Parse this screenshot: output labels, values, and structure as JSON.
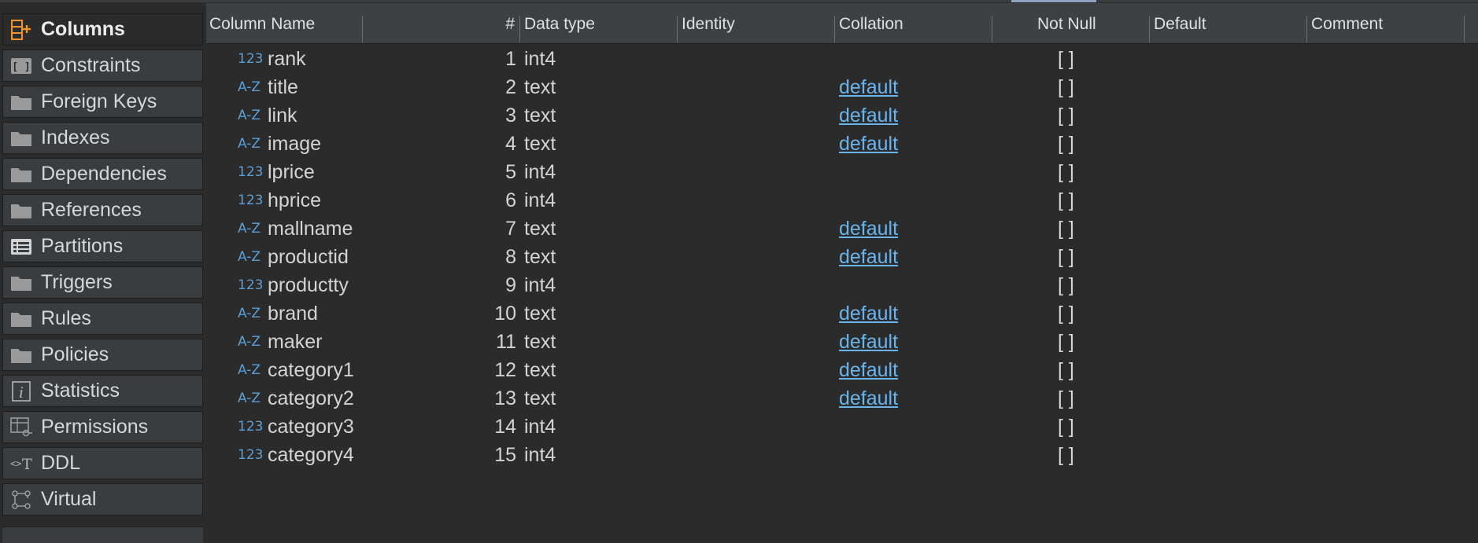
{
  "sidebar": {
    "items": [
      {
        "label": "Columns",
        "icon": "columns-icon",
        "active": true
      },
      {
        "label": "Constraints",
        "icon": "constraints-icon"
      },
      {
        "label": "Foreign Keys",
        "icon": "folder-icon"
      },
      {
        "label": "Indexes",
        "icon": "folder-icon"
      },
      {
        "label": "Dependencies",
        "icon": "folder-icon"
      },
      {
        "label": "References",
        "icon": "folder-icon"
      },
      {
        "label": "Partitions",
        "icon": "partitions-icon"
      },
      {
        "label": "Triggers",
        "icon": "folder-icon"
      },
      {
        "label": "Rules",
        "icon": "folder-icon"
      },
      {
        "label": "Policies",
        "icon": "folder-icon"
      },
      {
        "label": "Statistics",
        "icon": "statistics-icon"
      },
      {
        "label": "Permissions",
        "icon": "permissions-icon"
      },
      {
        "label": "DDL",
        "icon": "ddl-icon"
      },
      {
        "label": "Virtual",
        "icon": "virtual-icon"
      }
    ]
  },
  "table": {
    "headers": {
      "name": "Column Name",
      "num": "#",
      "type": "Data type",
      "identity": "Identity",
      "collation": "Collation",
      "notnull": "Not Null",
      "default": "Default",
      "comment": "Comment"
    },
    "type_icons": {
      "numeric": "123",
      "text": "A-Z"
    },
    "rows": [
      {
        "icon": "123",
        "name": "rank",
        "num": "1",
        "type": "int4",
        "collation": "",
        "notnull": "[ ]"
      },
      {
        "icon": "A-Z",
        "name": "title",
        "num": "2",
        "type": "text",
        "collation": "default",
        "notnull": "[ ]"
      },
      {
        "icon": "A-Z",
        "name": "link",
        "num": "3",
        "type": "text",
        "collation": "default",
        "notnull": "[ ]"
      },
      {
        "icon": "A-Z",
        "name": "image",
        "num": "4",
        "type": "text",
        "collation": "default",
        "notnull": "[ ]"
      },
      {
        "icon": "123",
        "name": "lprice",
        "num": "5",
        "type": "int4",
        "collation": "",
        "notnull": "[ ]"
      },
      {
        "icon": "123",
        "name": "hprice",
        "num": "6",
        "type": "int4",
        "collation": "",
        "notnull": "[ ]"
      },
      {
        "icon": "A-Z",
        "name": "mallname",
        "num": "7",
        "type": "text",
        "collation": "default",
        "notnull": "[ ]"
      },
      {
        "icon": "A-Z",
        "name": "productid",
        "num": "8",
        "type": "text",
        "collation": "default",
        "notnull": "[ ]"
      },
      {
        "icon": "123",
        "name": "productty",
        "num": "9",
        "type": "int4",
        "collation": "",
        "notnull": "[ ]"
      },
      {
        "icon": "A-Z",
        "name": "brand",
        "num": "10",
        "type": "text",
        "collation": "default",
        "notnull": "[ ]"
      },
      {
        "icon": "A-Z",
        "name": "maker",
        "num": "11",
        "type": "text",
        "collation": "default",
        "notnull": "[ ]"
      },
      {
        "icon": "A-Z",
        "name": "category1",
        "num": "12",
        "type": "text",
        "collation": "default",
        "notnull": "[ ]"
      },
      {
        "icon": "A-Z",
        "name": "category2",
        "num": "13",
        "type": "text",
        "collation": "default",
        "notnull": "[ ]"
      },
      {
        "icon": "123",
        "name": "category3",
        "num": "14",
        "type": "int4",
        "collation": "",
        "notnull": "[ ]"
      },
      {
        "icon": "123",
        "name": "category4",
        "num": "15",
        "type": "int4",
        "collation": "",
        "notnull": "[ ]"
      }
    ]
  },
  "colors": {
    "accent_orange": "#f0932b",
    "link_blue": "#6ab4ec",
    "type_icon_blue": "#5a9fd8"
  }
}
